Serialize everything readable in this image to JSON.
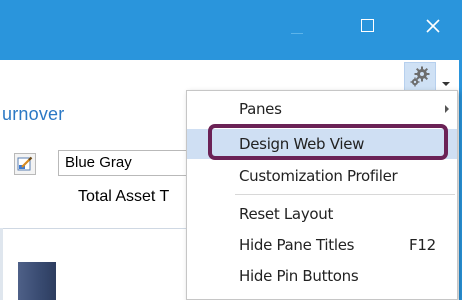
{
  "window": {
    "page_title": "urnover",
    "accent_color": "#2a95dc",
    "controls": [
      "minimize-icon",
      "maximize-icon",
      "close-icon"
    ]
  },
  "toolbar": {
    "settings_icon": "gear-icon"
  },
  "theme": {
    "value": "Blue Gray",
    "icon": "brush-icon"
  },
  "table": {
    "column_header": "Total Asset T"
  },
  "menu": {
    "items": [
      {
        "label": "Panes",
        "has_submenu": true
      },
      {
        "label": "Design Web View",
        "highlighted": true
      },
      {
        "label": "Customization Profiler"
      },
      {
        "label": "Reset Layout"
      },
      {
        "label": "Hide Pane Titles",
        "shortcut": "F12"
      },
      {
        "label": "Hide Pin Buttons"
      }
    ],
    "focus_color": "#6b2256"
  }
}
